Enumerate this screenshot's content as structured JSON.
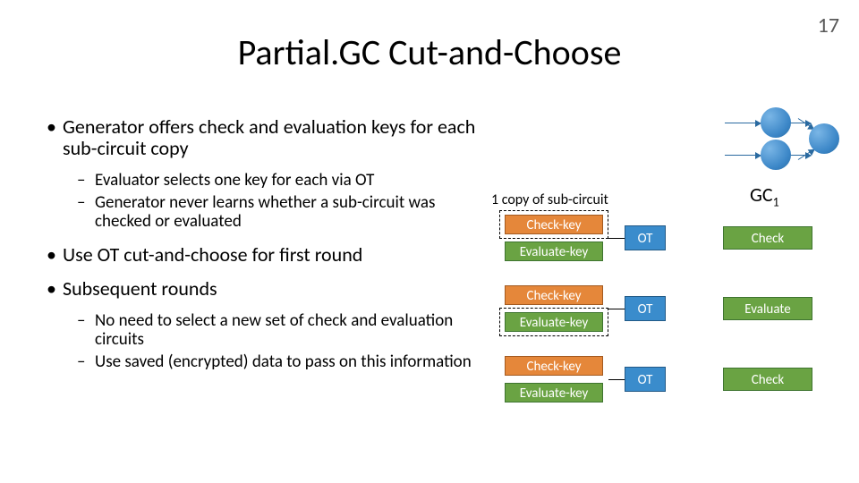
{
  "meta": {
    "slide_number": "17"
  },
  "title": "Partial.GC Cut-and-Choose",
  "bullets": {
    "b1": "Generator offers check and evaluation keys for each sub-circuit copy",
    "b1a": "Evaluator selects one key for each via OT",
    "b1b": "Generator never learns whether a sub-circuit was checked or evaluated",
    "b2": "Use OT cut-and-choose for first round",
    "b3": "Subsequent rounds",
    "b3a": "No need to select a new set of check and evaluation circuits",
    "b3b": "Use saved (encrypted) data to pass on this information"
  },
  "diagram": {
    "gc_label": "GC",
    "gc_sub": "1",
    "one_copy_label": "1 copy of sub-circuit",
    "check_key_label": "Check-key",
    "evaluate_key_label": "Evaluate-key",
    "ot_label": "OT",
    "result_labels": [
      "Check",
      "Evaluate",
      "Check"
    ],
    "rows": [
      {
        "selected": "check"
      },
      {
        "selected": "evaluate"
      },
      {
        "selected": "check"
      }
    ]
  }
}
